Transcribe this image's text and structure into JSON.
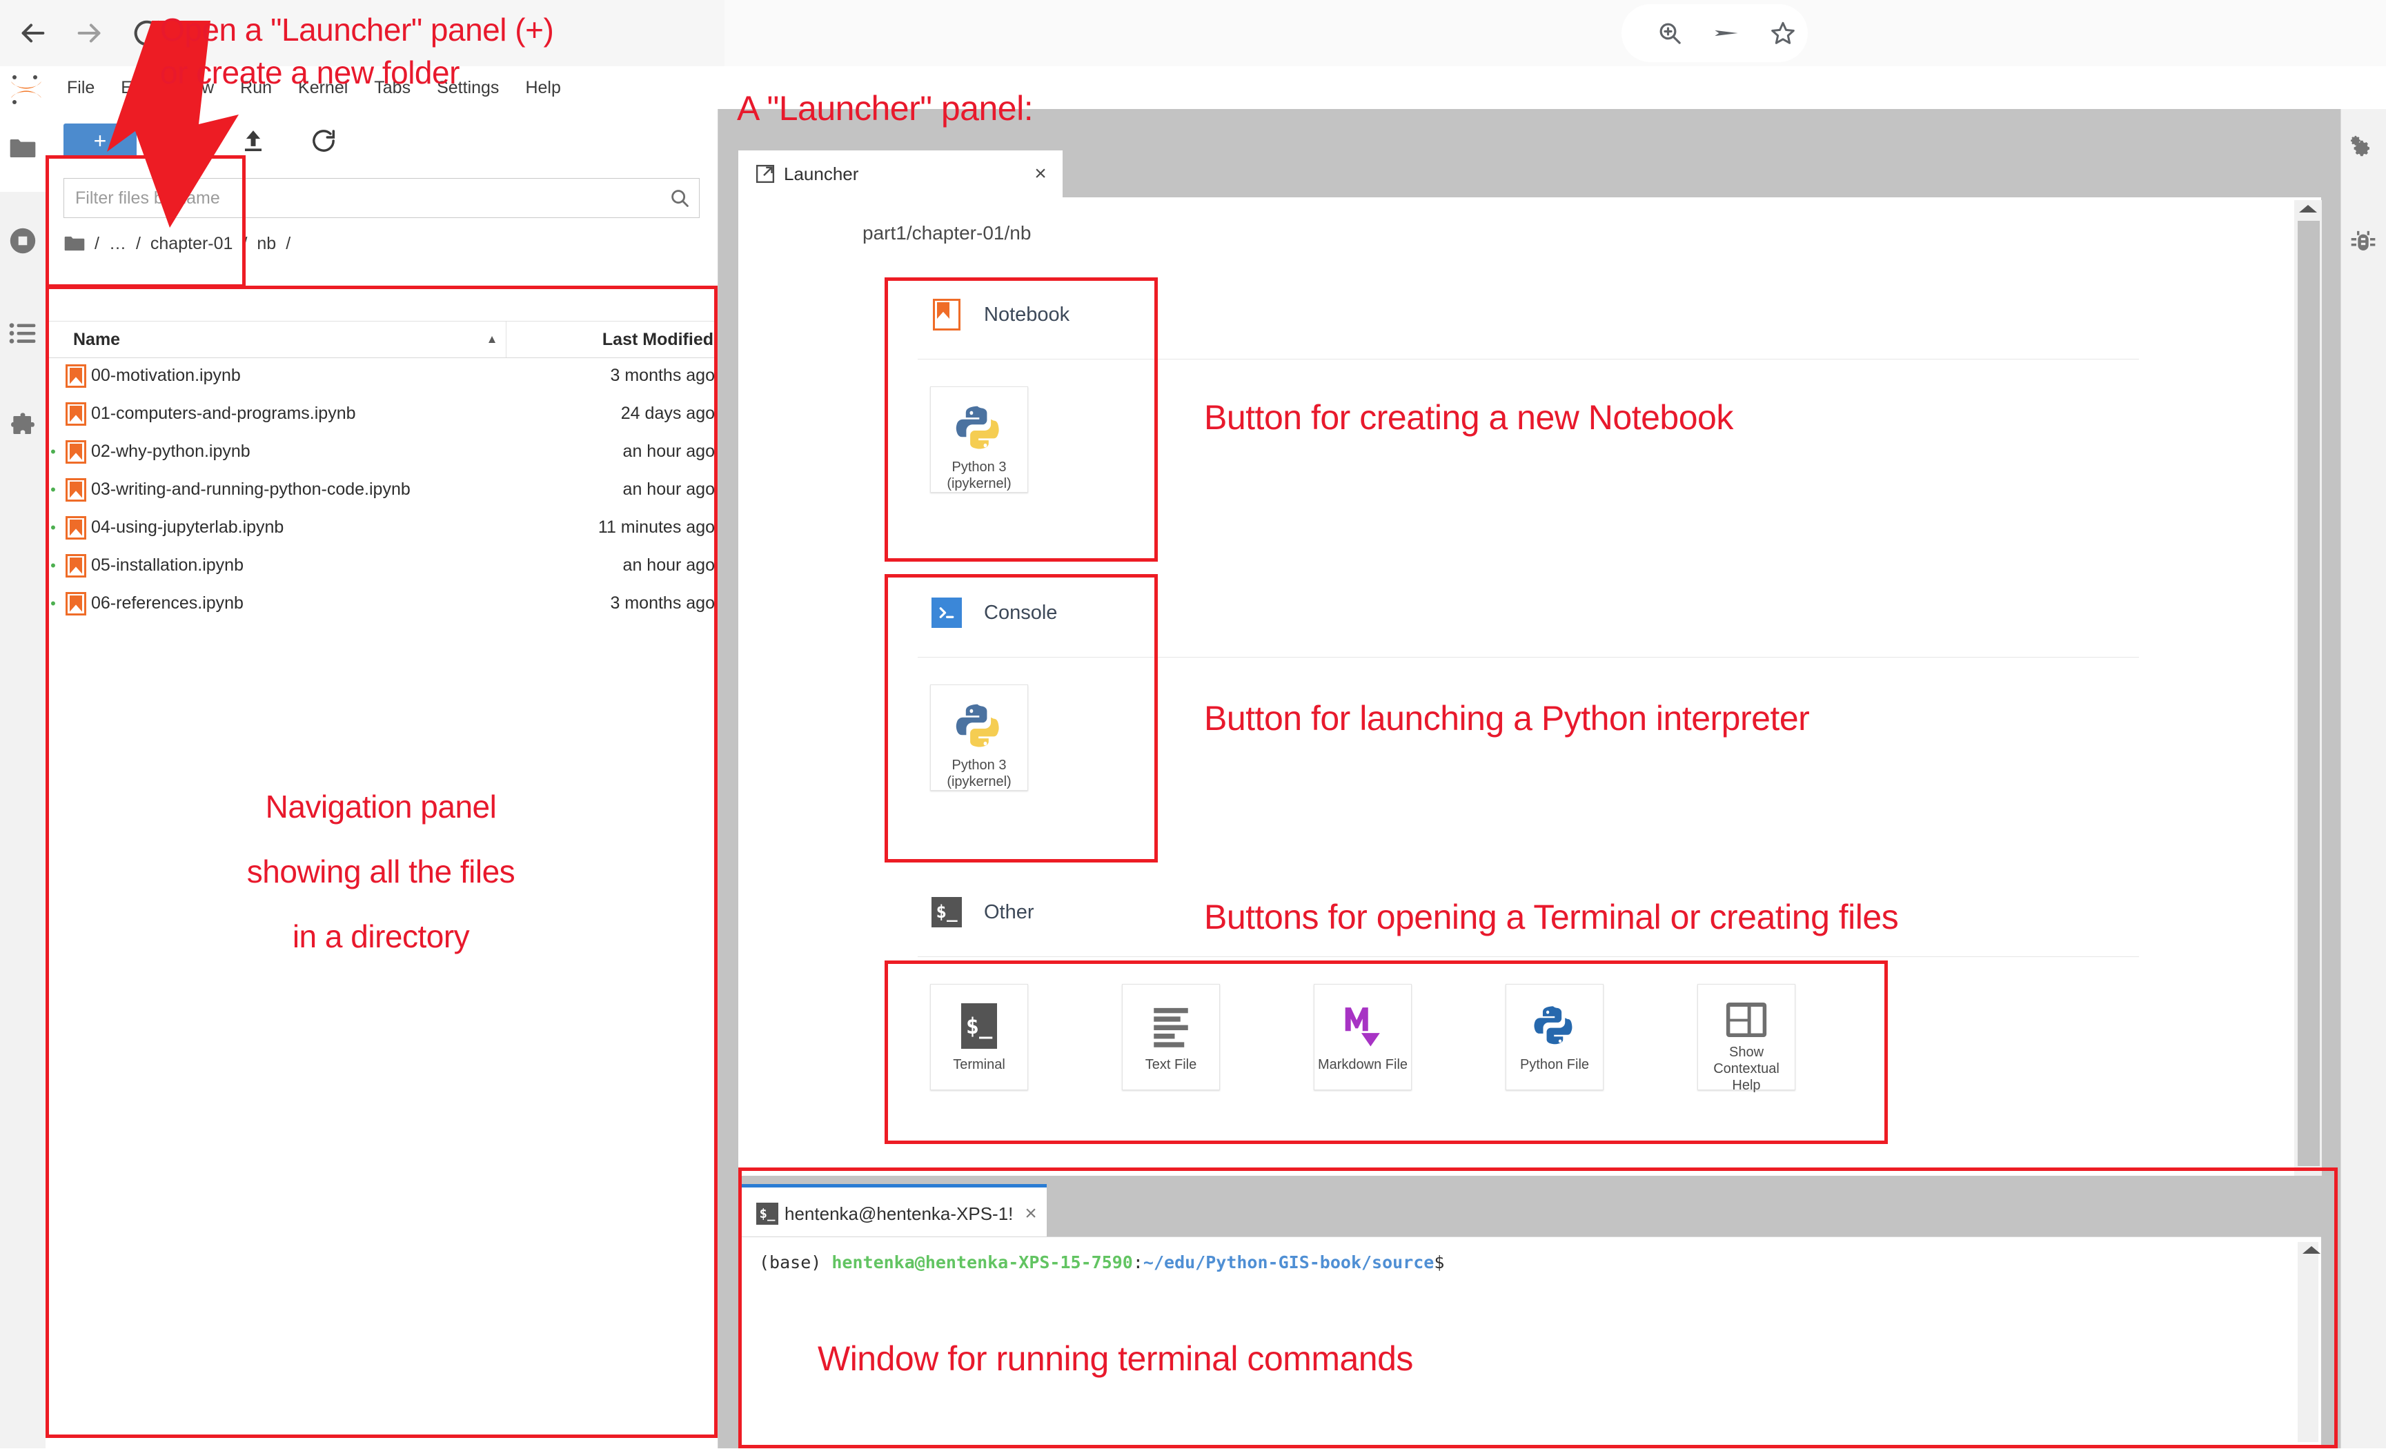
{
  "browser": {
    "nav": [
      {
        "name": "back-button",
        "glyph": "arrow-left"
      },
      {
        "name": "forward-button",
        "glyph": "arrow-right"
      },
      {
        "name": "reload-button",
        "glyph": "reload"
      }
    ],
    "actions": [
      {
        "name": "zoom-in-icon",
        "glyph": "magnifier-plus"
      },
      {
        "name": "share-icon",
        "glyph": "send-arrow"
      },
      {
        "name": "bookmark-icon",
        "glyph": "star"
      }
    ]
  },
  "menubar": {
    "logo": "jupyter-logo",
    "items": [
      "File",
      "Edit",
      "View",
      "Run",
      "Kernel",
      "Tabs",
      "Settings",
      "Help"
    ]
  },
  "left_sidebar": {
    "items": [
      {
        "name": "file-browser-icon",
        "label": "File Browser"
      },
      {
        "name": "running-sessions-icon",
        "label": "Running Terminals and Kernels"
      },
      {
        "name": "commands-icon",
        "label": "Commands"
      },
      {
        "name": "extension-manager-icon",
        "label": "Extension Manager"
      }
    ]
  },
  "right_sidebar": {
    "items": [
      {
        "name": "property-inspector-icon",
        "label": "Property Inspector"
      },
      {
        "name": "debugger-icon",
        "label": "Debugger"
      }
    ]
  },
  "filebrowser": {
    "toolbar": {
      "new_launcher_label": "+",
      "new_folder_icon": "new-folder-icon",
      "upload_icon": "upload-icon",
      "refresh_icon": "refresh-icon"
    },
    "filter_placeholder": "Filter files by name",
    "filter_value": "",
    "search_icon": "search-icon",
    "breadcrumb": [
      "/",
      "…",
      "/",
      "chapter-01",
      "/",
      "nb",
      "/"
    ],
    "columns": {
      "name": "Name",
      "modified": "Last Modified"
    },
    "sort_caret": "▲",
    "rows": [
      {
        "name": "00-motivation.ipynb",
        "modified": "3 months ago",
        "running": false
      },
      {
        "name": "01-computers-and-programs.ipynb",
        "modified": "24 days ago",
        "running": false
      },
      {
        "name": "02-why-python.ipynb",
        "modified": "an hour ago",
        "running": true
      },
      {
        "name": "03-writing-and-running-python-code.ipynb",
        "modified": "an hour ago",
        "running": true
      },
      {
        "name": "04-using-jupyterlab.ipynb",
        "modified": "11 minutes ago",
        "running": true
      },
      {
        "name": "05-installation.ipynb",
        "modified": "an hour ago",
        "running": true
      },
      {
        "name": "06-references.ipynb",
        "modified": "3 months ago",
        "running": true
      }
    ]
  },
  "launcher": {
    "tab_label": "Launcher",
    "tab_icon": "launcher-icon",
    "tab_close": "×",
    "cwd": "part1/chapter-01/nb",
    "sections": [
      {
        "key": "notebook",
        "title": "Notebook",
        "icon": "notebook-icon",
        "cards": [
          {
            "label": "Python 3\n(ipykernel)",
            "icon": "python-logo"
          }
        ]
      },
      {
        "key": "console",
        "title": "Console",
        "icon": "console-icon",
        "cards": [
          {
            "label": "Python 3\n(ipykernel)",
            "icon": "python-logo"
          }
        ]
      },
      {
        "key": "other",
        "title": "Other",
        "icon": "terminal-icon",
        "cards": [
          {
            "label": "Terminal",
            "icon": "terminal-icon"
          },
          {
            "label": "Text File",
            "icon": "text-file-icon"
          },
          {
            "label": "Markdown File",
            "icon": "markdown-icon"
          },
          {
            "label": "Python File",
            "icon": "python-file-icon"
          },
          {
            "label": "Show Contextual Help",
            "icon": "contextual-help-icon"
          }
        ]
      }
    ]
  },
  "terminal": {
    "tab_label": "hentenka@hentenka-XPS-1!",
    "tab_icon": "terminal-icon",
    "tab_close": "×",
    "prompt": {
      "env": "(base) ",
      "user_host": "hentenka@hentenka-XPS-15-7590",
      "colon": ":",
      "path": "~/edu/Python-GIS-book/source",
      "dollar": "$"
    }
  },
  "annotations": {
    "color": "#e8192c",
    "new_launcher": "Open a \"Launcher\" panel (+)\n   or create a new folder",
    "launcher_panel": "A \"Launcher\" panel:",
    "navigation_panel": "Navigation panel\nshowing all the files\nin a directory",
    "new_notebook": "Button for creating a new Notebook",
    "python_interpreter": "Button for launching a Python interpreter",
    "terminal_files": "Buttons for opening a Terminal or creating files",
    "terminal_window": "Window for running terminal commands"
  }
}
